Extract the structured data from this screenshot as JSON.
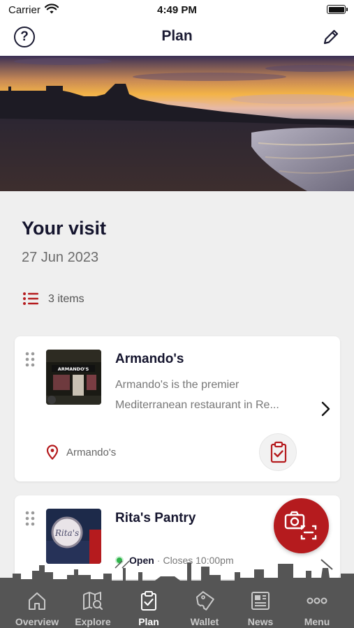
{
  "status_bar": {
    "carrier": "Carrier",
    "time": "4:49 PM"
  },
  "nav": {
    "title": "Plan",
    "help_icon": "help-circle-icon",
    "edit_icon": "pencil-icon"
  },
  "hero": {
    "description": "Sunset over a beach with an industrial skyline"
  },
  "visit": {
    "title": "Your visit",
    "date": "27 Jun 2023",
    "items_count": "3 items"
  },
  "items": [
    {
      "name": "Armando's",
      "description_line1": "Armando's is the premier",
      "description_line2": "Mediterranean restaurant in Re...",
      "location": "Armando's",
      "thumb_sign": "ARMANDO'S"
    },
    {
      "name": "Rita's Pantry",
      "status_open": "Open",
      "status_sep": "·",
      "status_close": "Closes 10:00pm",
      "thumb_sign": "Rita's"
    }
  ],
  "tabs": [
    {
      "label": "Overview",
      "icon": "house-icon",
      "active": false
    },
    {
      "label": "Explore",
      "icon": "map-search-icon",
      "active": false
    },
    {
      "label": "Plan",
      "icon": "clipboard-check-icon",
      "active": true
    },
    {
      "label": "Wallet",
      "icon": "ticket-icon",
      "active": false
    },
    {
      "label": "News",
      "icon": "newspaper-icon",
      "active": false
    },
    {
      "label": "Menu",
      "icon": "more-dots-icon",
      "active": false
    }
  ],
  "colors": {
    "accent": "#b51b1e",
    "heading": "#15152e",
    "tab_bar": "#555555",
    "open": "#2fb34a"
  }
}
